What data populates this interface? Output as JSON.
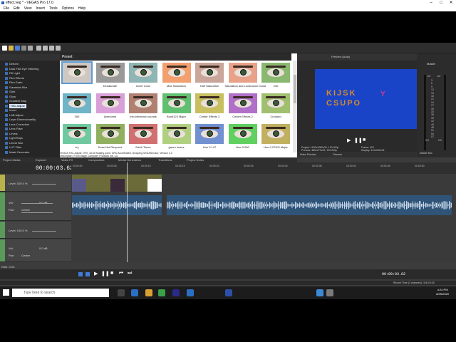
{
  "window": {
    "title": "effect.veg * - VEGAS Pro 17.0",
    "controls": [
      "–",
      "□",
      "✕"
    ]
  },
  "menu": [
    "File",
    "Edit",
    "View",
    "Insert",
    "Tools",
    "Options",
    "Help"
  ],
  "fx_list": {
    "items": [
      "Deform",
      "Dual Fish Eye Stitching",
      "Fill Light",
      "Film Effects",
      "Film Grain",
      "Gaussian Blur",
      "Glint",
      "Glow",
      "Gradient Map",
      "HSL Adjust",
      "Invert",
      "LAB Adjust",
      "Layer Dimensionality",
      "Lens Correction",
      "Lens Flare",
      "Levels",
      "Light Rays",
      "Linear Blur",
      "LUT Filter",
      "Mask Generator"
    ],
    "selected_index": 9
  },
  "presets": {
    "header": "Preset:",
    "items": [
      {
        "label": "",
        "tint": "#cfc8c2"
      },
      {
        "label": "Desaturate",
        "tint": "#9a9a9a"
      },
      {
        "label": "Invert Color",
        "tint": "#8fb5b5"
      },
      {
        "label": "Max Saturation",
        "tint": "#f2a070"
      },
      {
        "label": "Half Saturation",
        "tint": "#c9a59a"
      },
      {
        "label": "Saturation and Luminance boost",
        "tint": "#e8a28a"
      },
      {
        "label": "240",
        "tint": "#8ab870"
      },
      {
        "label": "350",
        "tint": "#70b4c8"
      },
      {
        "label": "Awesome",
        "tint": "#d8a0d8"
      },
      {
        "label": "Info elentonic sounds",
        "tint": "#b08070"
      },
      {
        "label": "Boulf123 Major",
        "tint": "#60c070"
      },
      {
        "label": "Center Effects 2",
        "tint": "#c8c060"
      },
      {
        "label": "Center Effects 2",
        "tint": "#b070c8"
      },
      {
        "label": "Crooked",
        "tint": "#a0c070"
      },
      {
        "label": "cry",
        "tint": "#70c8a0"
      },
      {
        "label": "Does Not Respond",
        "tint": "#90b060"
      },
      {
        "label": "Earth Tones",
        "tint": "#d07070"
      },
      {
        "label": "green lovers",
        "tint": "#b0d080"
      },
      {
        "label": "Hue 0.147",
        "tint": "#7090d0"
      },
      {
        "label": "Hue 0.250",
        "tint": "#60d060"
      },
      {
        "label": "Hue 0.275/G Major",
        "tint": "#c0b060"
      }
    ]
  },
  "fx_info": {
    "line1": "VEGAS HSL Adjust: OFX, 32-bit floating point, GPU Accelerated, Grouping VEGAS\\Color, Version 1.0",
    "line2": "Description: From Magix Computer Products Intl. Co."
  },
  "dock_tabs": [
    "Project Media",
    "Explorer",
    "Video FX",
    "Compositors",
    "Media Generators",
    "Transitions",
    "Project Notes"
  ],
  "preview": {
    "header": "Preview (Auto)",
    "screen_line1": "KIJSK",
    "screen_line2": "CSUPO",
    "info": {
      "project": "Project:   1920x1080x32, 120.000p",
      "preview": "Preview:   480x270x32, 120.000p",
      "frame": "Frame:   422",
      "display": "Display:   412x232x32"
    },
    "tabs": [
      "Video Preview",
      "Trimmer"
    ]
  },
  "master": {
    "label": "Master",
    "bus_label": "Master Bus",
    "ticks": [
      "3",
      "6",
      "9",
      "12",
      "15",
      "18",
      "21",
      "24",
      "27",
      "30",
      "33",
      "36",
      "39",
      "42",
      "45",
      "48",
      "51",
      "54",
      "57"
    ],
    "readout": [
      "-Inf",
      "-Inf"
    ],
    "db": [
      "0.0",
      "0.0"
    ]
  },
  "timeline": {
    "timecode": "00:00:03.62",
    "ruler": [
      "00:00:00",
      "00:00:05",
      "00:00:10",
      "00:00:15",
      "00:00:20",
      "00:00:25",
      "00:00:30",
      "00:00:35",
      "00:00:40",
      "00:00:45",
      "00:00:50"
    ],
    "tracks": [
      {
        "type": "video",
        "level": "Level: 100.0 %",
        "num": "1"
      },
      {
        "type": "audio",
        "vol": "0.0 dB",
        "pan": "Center",
        "num": "2"
      },
      {
        "type": "video",
        "level": "Level: 100.0 %",
        "num": "3"
      },
      {
        "type": "audio",
        "vol": "0.0 dB",
        "pan": "Center",
        "num": "4"
      }
    ],
    "labels": {
      "vol": "Vol:",
      "pan": "Pan:"
    }
  },
  "transport": {
    "rate": "Rate: 0.00",
    "time": "00:00:03.62"
  },
  "status": "Record Time (2 channels): 316:24:15",
  "taskbar": {
    "search_placeholder": "Type here to search",
    "time": "4:24 PM",
    "date": "8/25/2020"
  },
  "colors": {
    "accent": "#5b9bd5",
    "preview_bg": "#1a44c8",
    "video_track": "#6b6b3a",
    "audio_track": "#2f5478"
  }
}
